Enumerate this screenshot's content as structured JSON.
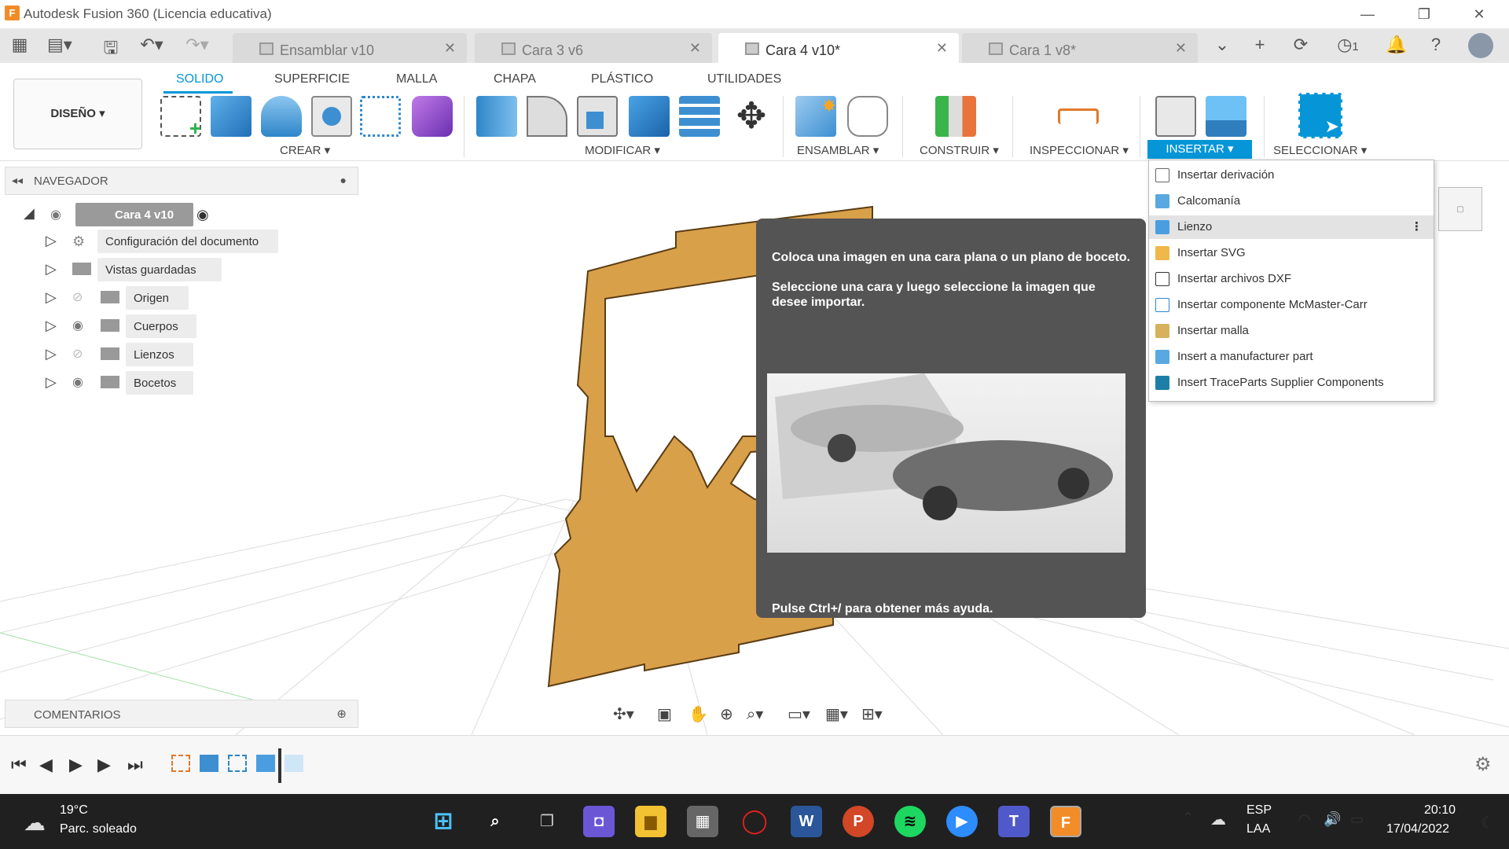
{
  "window": {
    "title": "Autodesk Fusion 360 (Licencia educativa)",
    "logo": "F"
  },
  "tabs": [
    {
      "label": "Ensamblar v10",
      "active": false
    },
    {
      "label": "Cara 3 v6",
      "active": false
    },
    {
      "label": "Cara 4 v10*",
      "active": true
    },
    {
      "label": "Cara 1 v8*",
      "active": false
    }
  ],
  "quick": {
    "jobs_count": "1"
  },
  "ribbon": {
    "design_button": "DISEÑO ▾",
    "tabs": [
      "SOLIDO",
      "SUPERFICIE",
      "MALLA",
      "CHAPA",
      "PLÁSTICO",
      "UTILIDADES"
    ],
    "groups": {
      "create": "CREAR ▾",
      "modify": "MODIFICAR ▾",
      "assemble": "ENSAMBLAR ▾",
      "construct": "CONSTRUIR ▾",
      "inspect": "INSPECCIONAR ▾",
      "insert": "INSERTAR ▾",
      "select": "SELECCIONAR ▾"
    }
  },
  "navigator": {
    "header": "NAVEGADOR",
    "root": "Cara 4 v10",
    "items": [
      "Configuración del documento",
      "Vistas guardadas",
      "Origen",
      "Cuerpos",
      "Lienzos",
      "Bocetos"
    ]
  },
  "comments": "COMENTARIOS",
  "tooltip": {
    "p1": "Coloca una imagen en una cara plana o un plano de boceto.",
    "p2": "Seleccione una cara y luego seleccione la imagen que desee importar.",
    "footer": "Pulse Ctrl+/ para obtener más ayuda."
  },
  "insert_menu": [
    "Insertar derivación",
    "Calcomanía",
    "Lienzo",
    "Insertar SVG",
    "Insertar archivos DXF",
    "Insertar componente McMaster-Carr",
    "Insertar malla",
    "Insert a manufacturer part",
    "Insert TraceParts Supplier Components"
  ],
  "colors": {
    "accent": "#0696d7",
    "part": "#d9a04a"
  },
  "taskbar": {
    "weather_temp": "19°C",
    "weather_desc": "Parc. soleado",
    "lang": "ESP",
    "lang2": "LAA",
    "time": "20:10",
    "date": "17/04/2022"
  }
}
